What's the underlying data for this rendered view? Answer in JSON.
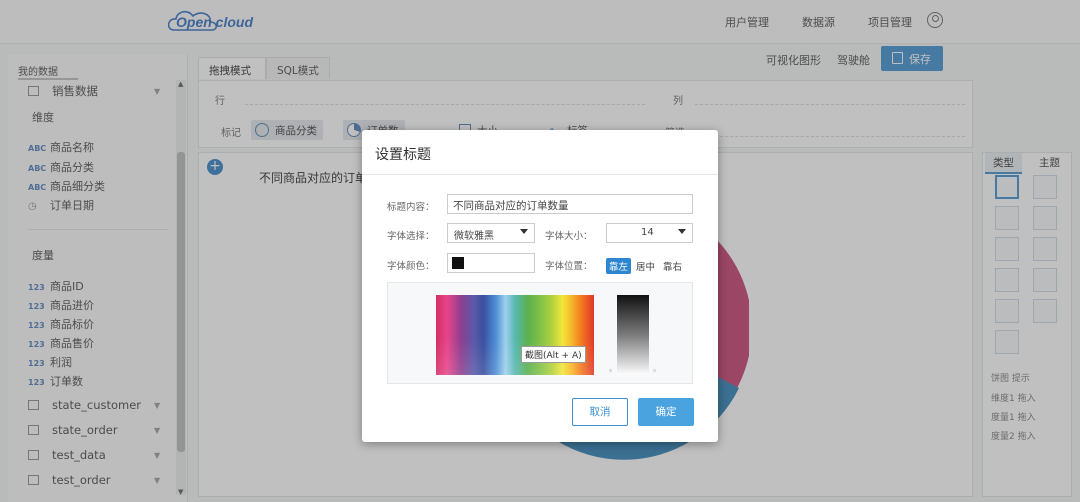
{
  "header": {
    "logo_text": "Open cloud",
    "nav": [
      "用户管理",
      "数据源",
      "项目管理"
    ]
  },
  "sidebar": {
    "tab": "我的数据",
    "dataset": "销售数据",
    "dimension_title": "维度",
    "dimensions": [
      {
        "type": "ABC",
        "label": "商品名称"
      },
      {
        "type": "ABC",
        "label": "商品分类"
      },
      {
        "type": "ABC",
        "label": "商品细分类"
      },
      {
        "type": "date",
        "label": "订单日期"
      }
    ],
    "measure_title": "度量",
    "measures": [
      {
        "type": "123",
        "label": "商品ID"
      },
      {
        "type": "123",
        "label": "商品进价"
      },
      {
        "type": "123",
        "label": "商品标价"
      },
      {
        "type": "123",
        "label": "商品售价"
      },
      {
        "type": "123",
        "label": "利润"
      },
      {
        "type": "123",
        "label": "订单数"
      }
    ],
    "tables": [
      "state_customer",
      "state_order",
      "test_data",
      "test_order"
    ]
  },
  "main": {
    "tabs": [
      "拖拽模式",
      "SQL模式"
    ],
    "viz_label": "可视化图形",
    "dashboard_label": "驾驶舱",
    "save_label": "保存",
    "row_label": "行",
    "col_label": "列",
    "mark_label": "标记",
    "pills": [
      "商品分类",
      "订单数"
    ],
    "marks": [
      "大小",
      "标签"
    ],
    "filter_label": "筛选",
    "chart_title": "不同商品对应的订单数量"
  },
  "right_panel": {
    "tabs": [
      "类型",
      "主题"
    ],
    "hint": "饼图 提示",
    "fields": [
      "维度1 拖入",
      "度量1 拖入",
      "度量2 拖入"
    ]
  },
  "dialog": {
    "title": "设置标题",
    "content_label": "标题内容：",
    "content_value": "不同商品对应的订单数量",
    "font_label": "字体选择：",
    "font_value": "微软雅黑",
    "size_label": "字体大小：",
    "size_value": "14",
    "color_label": "字体颜色：",
    "color_value": "#111111",
    "position_label": "字体位置：",
    "positions": [
      "靠左",
      "居中",
      "靠右"
    ],
    "position_selected": "靠左",
    "tooltip": "截图(Alt + A)",
    "cancel_label": "取消",
    "ok_label": "确定"
  },
  "colors": {
    "accent": "#3a8fd1",
    "overlay": "#5a5a5a"
  }
}
